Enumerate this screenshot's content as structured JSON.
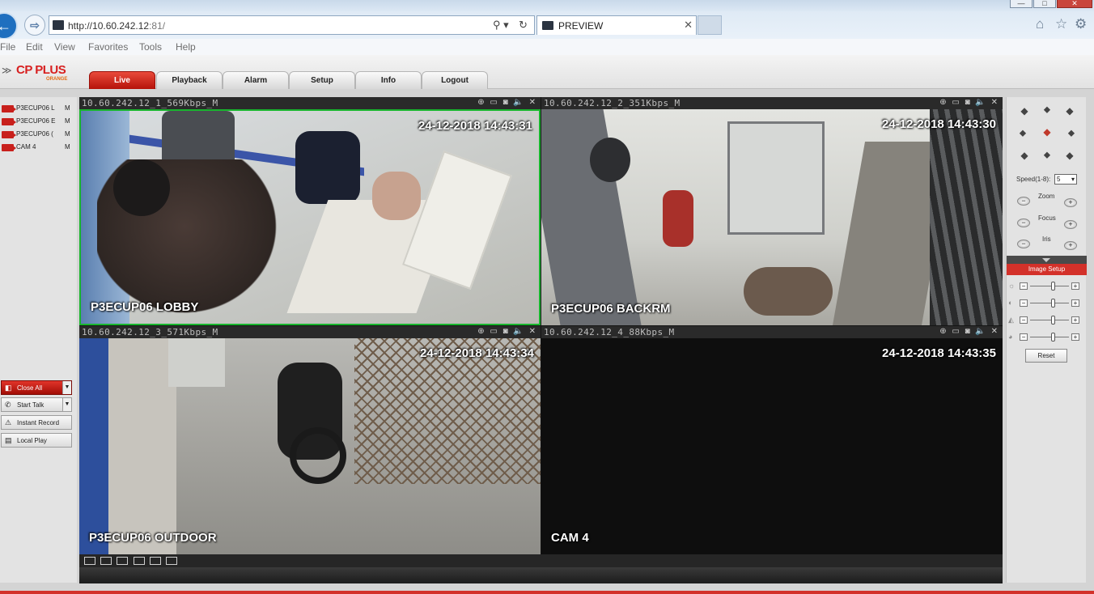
{
  "browser": {
    "url_host": "http://10.60.242.12",
    "url_port": ":81/",
    "tab_title": "PREVIEW",
    "window_buttons": {
      "minimize": "—",
      "maximize": "□",
      "close": "✕"
    },
    "menu": [
      "File",
      "Edit",
      "View",
      "Favorites",
      "Tools",
      "Help"
    ],
    "icons": [
      "back-arrow-icon",
      "forward-arrow-icon",
      "search-icon",
      "refresh-icon",
      "home-icon",
      "star-icon",
      "gear-icon"
    ]
  },
  "app": {
    "logo": {
      "brand": "CP PLUS",
      "sub": "ORANGE"
    },
    "tabs": [
      "Live",
      "Playback",
      "Alarm",
      "Setup",
      "Info",
      "Logout"
    ],
    "active_tab": "Live",
    "accent_color": "#d3312a",
    "cameras": [
      {
        "label": "P3ECUP06 L",
        "stream": "M"
      },
      {
        "label": "P3ECUP06 E",
        "stream": "M"
      },
      {
        "label": "P3ECUP06 (",
        "stream": "M"
      },
      {
        "label": "CAM 4",
        "stream": "M"
      }
    ],
    "buttons": {
      "close_all": "Close All",
      "start_talk": "Start Talk",
      "instant_record": "Instant Record",
      "local_play": "Local Play"
    },
    "tiles": [
      {
        "header": "10.60.242.12_1_569Kbps_M",
        "timestamp": "24-12-2018 14:43:31",
        "caption": "P3ECUP06 LOBBY",
        "selected": true
      },
      {
        "header": "10.60.242.12_2_351Kbps_M",
        "timestamp": "24-12-2018 14:43:30",
        "caption": "P3ECUP06 BACKRM",
        "selected": false
      },
      {
        "header": "10.60.242.12_3_571Kbps_M",
        "timestamp": "24-12-2018 14:43:34",
        "caption": "P3ECUP06 OUTDOOR",
        "selected": false
      },
      {
        "header": "10.60.242.12_4_88Kbps_M",
        "timestamp": "24-12-2018 14:43:35",
        "caption": "CAM 4",
        "selected": false
      }
    ],
    "tile_icons": "⊕ ▭ ◙ 🔈 ✕",
    "ptz": {
      "speed_label": "Speed(1-8):",
      "speed_value": "5",
      "zoom_label": "Zoom",
      "focus_label": "Focus",
      "iris_label": "Iris",
      "image_setup_label": "Image Setup",
      "reset_label": "Reset",
      "sliders": [
        {
          "name": "brightness",
          "level": 0.6
        },
        {
          "name": "contrast",
          "level": 0.6
        },
        {
          "name": "saturation",
          "level": 0.6
        },
        {
          "name": "hue",
          "level": 0.6
        }
      ]
    }
  }
}
